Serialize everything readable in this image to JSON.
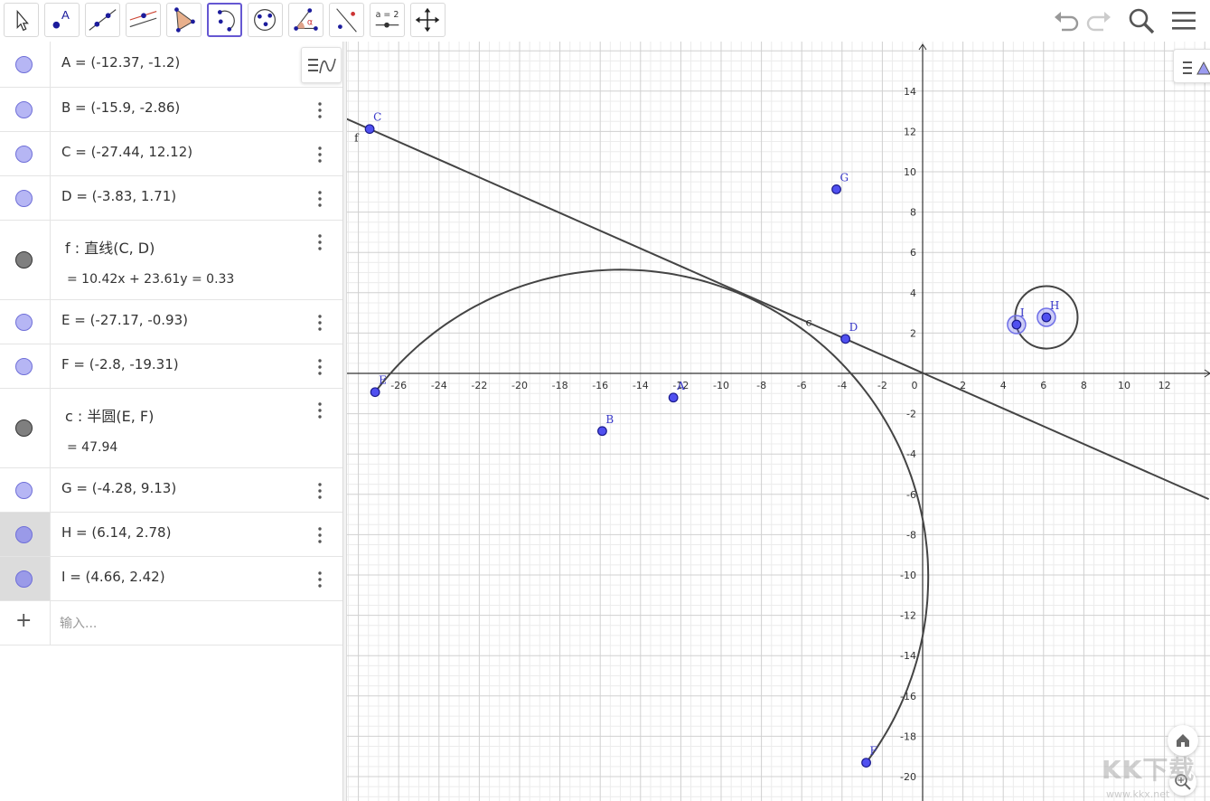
{
  "toolbar": {
    "tools": [
      {
        "name": "move-tool",
        "icon": "arrow-cursor-icon"
      },
      {
        "name": "point-tool",
        "icon": "point-icon",
        "label": "A"
      },
      {
        "name": "line-tool",
        "icon": "line-through-points-icon"
      },
      {
        "name": "perpendicular-line-tool",
        "icon": "perpendicular-line-icon"
      },
      {
        "name": "polygon-tool",
        "icon": "polygon-icon"
      },
      {
        "name": "semicircle-tool",
        "icon": "semicircle-icon"
      },
      {
        "name": "circle-tool",
        "icon": "circle-through-points-icon"
      },
      {
        "name": "angle-tool",
        "icon": "angle-icon",
        "label": "α"
      },
      {
        "name": "reflect-tool",
        "icon": "reflect-about-line-icon"
      },
      {
        "name": "slider-tool",
        "icon": "slider-icon",
        "label": "a = 2"
      },
      {
        "name": "move-graphics-view-tool",
        "icon": "move-graphics-icon"
      }
    ],
    "active_tool": "semicircle-tool"
  },
  "algebra": {
    "rows": [
      {
        "id": "A",
        "text": "A = (-12.37, -1.2)",
        "style": "point"
      },
      {
        "id": "B",
        "text": "B = (-15.9, -2.86)",
        "style": "point"
      },
      {
        "id": "C",
        "text": "C = (-27.44, 12.12)",
        "style": "point"
      },
      {
        "id": "D",
        "text": "D = (-3.83, 1.71)",
        "style": "point"
      },
      {
        "id": "f",
        "definition": "f : 直线(C, D)",
        "value": "=   10.42x  +  23.61y  =  0.33",
        "style": "line"
      },
      {
        "id": "E",
        "text": "E = (-27.17, -0.93)",
        "style": "point"
      },
      {
        "id": "F",
        "text": "F = (-2.8, -19.31)",
        "style": "point"
      },
      {
        "id": "c",
        "definition": "c : 半圆(E, F)",
        "value": "=   47.94",
        "style": "line"
      },
      {
        "id": "G",
        "text": "G = (-4.28, 9.13)",
        "style": "point"
      },
      {
        "id": "H",
        "text": "H = (6.14, 2.78)",
        "style": "point",
        "selected": true
      },
      {
        "id": "I",
        "text": "I = (4.66, 2.42)",
        "style": "point",
        "selected": true
      }
    ],
    "input_placeholder": "输入..."
  },
  "colors": {
    "point_fill": "#5050f0",
    "point_border": "#1a1a8c",
    "object_stroke": "#444444",
    "grid_major": "#d0d0d0",
    "grid_minor": "#ececec",
    "label_blue": "#3535c8"
  },
  "graph": {
    "x_ticks": [
      "-26",
      "-24",
      "-22",
      "-20",
      "-18",
      "-16",
      "-14",
      "-12",
      "-10",
      "-8",
      "-6",
      "-4",
      "-2",
      "0",
      "2",
      "4",
      "6",
      "8",
      "10",
      "12"
    ],
    "y_ticks": [
      "14",
      "12",
      "10",
      "8",
      "6",
      "4",
      "2",
      "-2",
      "-4",
      "-6",
      "-8",
      "-10",
      "-12",
      "-14",
      "-16",
      "-18",
      "-20"
    ],
    "points": [
      {
        "label": "A",
        "x": -12.37,
        "y": -1.2
      },
      {
        "label": "B",
        "x": -15.9,
        "y": -2.86
      },
      {
        "label": "C",
        "x": -27.44,
        "y": 12.12
      },
      {
        "label": "D",
        "x": -3.83,
        "y": 1.71
      },
      {
        "label": "E",
        "x": -27.17,
        "y": -0.93
      },
      {
        "label": "F",
        "x": -2.8,
        "y": -19.31
      },
      {
        "label": "G",
        "x": -4.28,
        "y": 9.13
      },
      {
        "label": "H",
        "x": 6.14,
        "y": 2.78,
        "selected": true
      },
      {
        "label": "I",
        "x": 4.66,
        "y": 2.42,
        "selected": true
      }
    ],
    "line_label": "f",
    "semicircle_label": "c",
    "circle": {
      "cx": 6.14,
      "cy": 2.78,
      "r": 1.55
    }
  },
  "watermark": {
    "text": "KK下载",
    "sub": "www.kkx.net"
  }
}
